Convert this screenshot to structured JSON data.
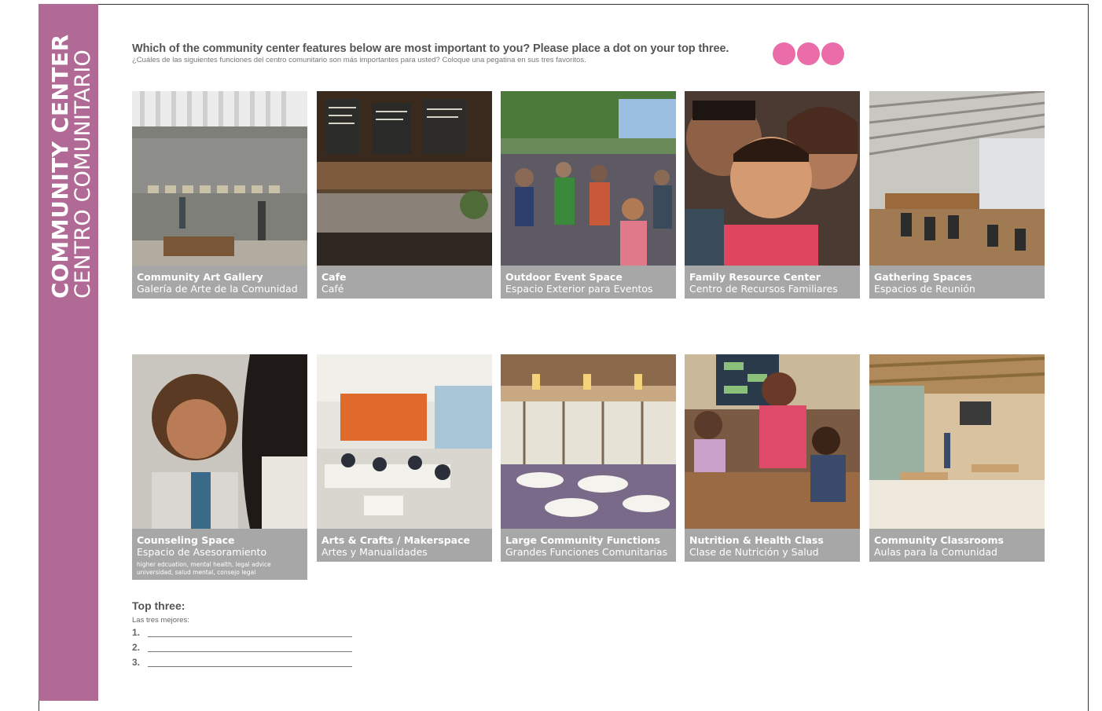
{
  "sidebar": {
    "title_en": "COMMUNITY CENTER",
    "title_es": "CENTRO COMUNITARIO",
    "color": "#b06a95"
  },
  "question": {
    "en": "Which of the community center features below are most important to you? Please place a dot on your top three.",
    "es": "¿Cuáles de las siguientes funciones del centro comunitario son más importantes para usted? Coloque una pegatina en sus tres favoritos."
  },
  "dot_color": "#ea6ca8",
  "cards": [
    {
      "title": "Community Art Gallery",
      "subtitle": "Galería de Arte de la Comunidad",
      "note": ""
    },
    {
      "title": "Cafe",
      "subtitle": "Café",
      "note": ""
    },
    {
      "title": "Outdoor Event Space",
      "subtitle": "Espacio Exterior para Eventos",
      "note": ""
    },
    {
      "title": "Family Resource Center",
      "subtitle": "Centro de Recursos Familiares",
      "note": ""
    },
    {
      "title": "Gathering Spaces",
      "subtitle": "Espacios de Reunión",
      "note": ""
    },
    {
      "title": "Counseling Space",
      "subtitle": "Espacio de Asesoramiento",
      "note": "higher edcuation, mental health, legal advice universidad, salud mental, consejo legal"
    },
    {
      "title": "Arts & Crafts / Makerspace",
      "subtitle": "Artes y Manualidades",
      "note": ""
    },
    {
      "title": "Large Community Functions",
      "subtitle": "Grandes Funciones Comunitarias",
      "note": ""
    },
    {
      "title": "Nutrition & Health Class",
      "subtitle": "Clase de Nutrición y Salud",
      "note": ""
    },
    {
      "title": "Community Classrooms",
      "subtitle": "Aulas para la Comunidad",
      "note": ""
    }
  ],
  "top_three": {
    "title": "Top three:",
    "subtitle": "Las tres mejores:",
    "lines": [
      "1.",
      "2.",
      "3."
    ]
  }
}
